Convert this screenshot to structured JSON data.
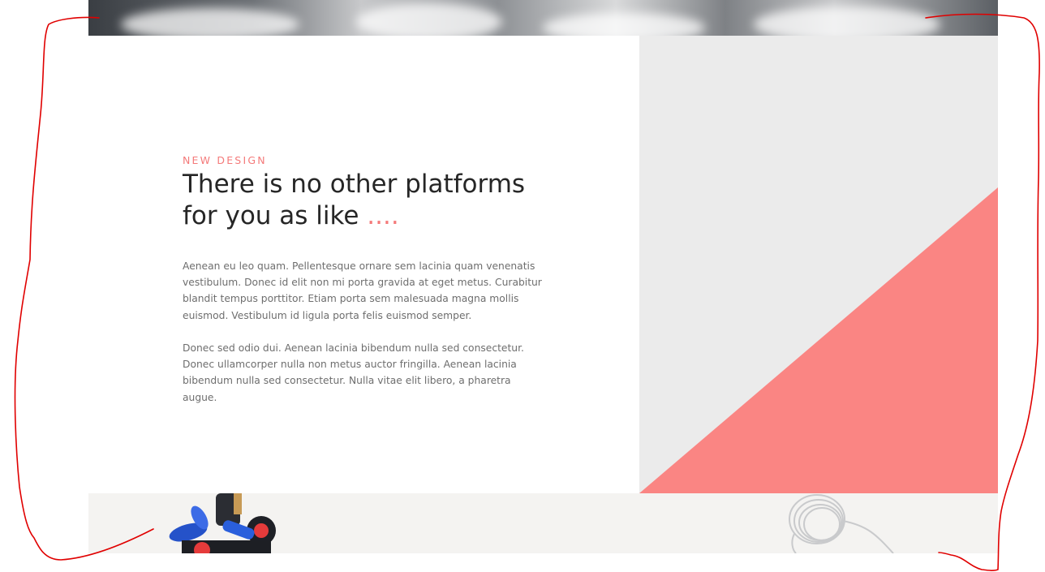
{
  "hero": {
    "image": "cloudy-mountain-photo"
  },
  "feature": {
    "eyebrow": "NEW DESIGN",
    "headline_line1": "There is no other platforms",
    "headline_line2": "for you as like ",
    "headline_accent": "....",
    "paragraph_1": "Aenean eu leo quam. Pellentesque ornare sem lacinia quam venenatis vestibulum. Donec id elit non mi porta gravida at eget metus. Curabitur blandit tempus porttitor. Etiam porta sem malesuada magna mollis euismod. Vestibulum id ligula porta felis euismod semper.",
    "paragraph_2": "Donec sed odio dui. Aenean lacinia bibendum nulla sed consectetur. Donec ullamcorper nulla non metus auctor fringilla. Aenean lacinia bibendum nulla sed consectetur. Nulla vitae elit libero, a pharetra augue."
  },
  "art": {
    "panel_color": "#ebebeb",
    "triangle_color": "#fa8583"
  },
  "bottom": {
    "left_image": "pens-in-cup-photo",
    "right_image": "earphones-cable-photo"
  },
  "colors": {
    "accent": "#f47a7a",
    "annotation": "#e00000"
  }
}
